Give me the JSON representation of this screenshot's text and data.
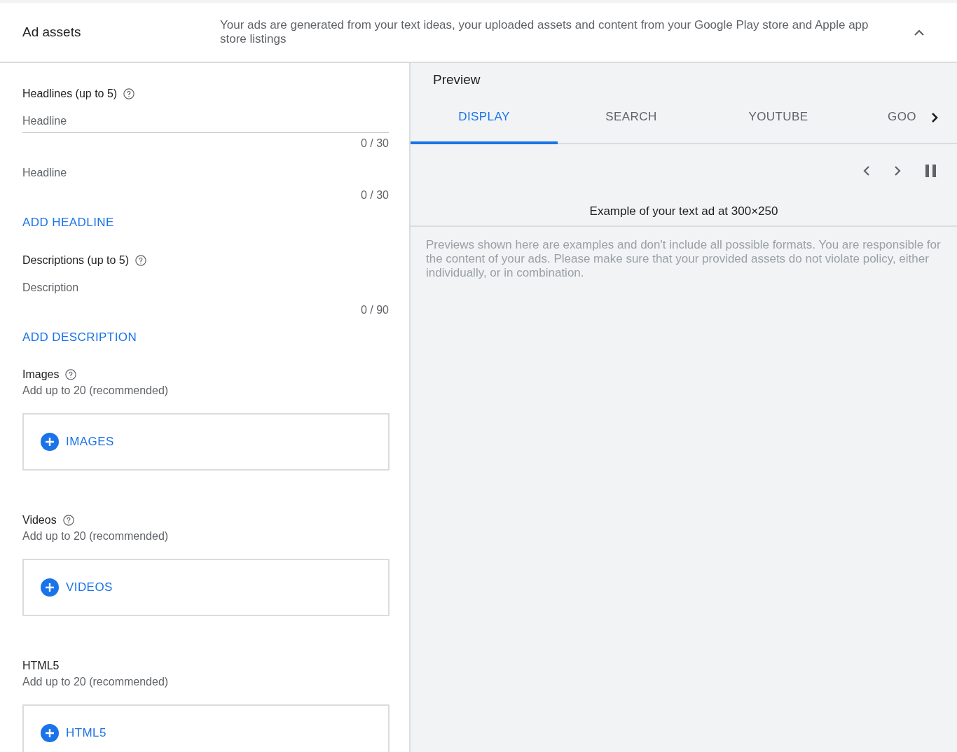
{
  "header": {
    "title": "Ad assets",
    "description": "Your ads are generated from your text ideas, your uploaded assets and content from your Google Play store and Apple app store listings",
    "expanded": true
  },
  "sections": [
    {
      "kind": "text",
      "label": "Headlines (up to 5)",
      "help": true,
      "fields": [
        {
          "placeholder": "Headline",
          "counter": "0 / 30",
          "focused": true
        },
        {
          "placeholder": "Headline",
          "counter": "0 / 30",
          "focused": false
        }
      ],
      "add_link": "ADD HEADLINE"
    },
    {
      "kind": "text",
      "label": "Descriptions (up to 5)",
      "help": true,
      "fields": [
        {
          "placeholder": "Description",
          "counter": "0 / 90",
          "focused": false
        }
      ],
      "add_link": "ADD DESCRIPTION"
    },
    {
      "kind": "upload",
      "label": "Images",
      "help": true,
      "hint": "Add up to 20 (recommended)",
      "button": "IMAGES"
    },
    {
      "kind": "upload",
      "label": "Videos",
      "help": true,
      "hint": "Add up to 20 (recommended)",
      "button": "VIDEOS"
    },
    {
      "kind": "upload",
      "label": "HTML5",
      "help": false,
      "hint": "Add up to 20 (recommended)",
      "button": "HTML5"
    }
  ],
  "preview": {
    "title": "Preview",
    "tabs": [
      {
        "label": "DISPLAY",
        "selected": true
      },
      {
        "label": "SEARCH",
        "selected": false
      },
      {
        "label": "YOUTUBE",
        "selected": false
      },
      {
        "label": "GOO",
        "selected": false
      }
    ],
    "caption": "Example of your text ad at 300×250",
    "disclaimer": "Previews shown here are examples and don't include all possible formats. You are responsible for the content of your ads. Please make sure that your provided assets do not violate policy, either individually, or in combination."
  }
}
